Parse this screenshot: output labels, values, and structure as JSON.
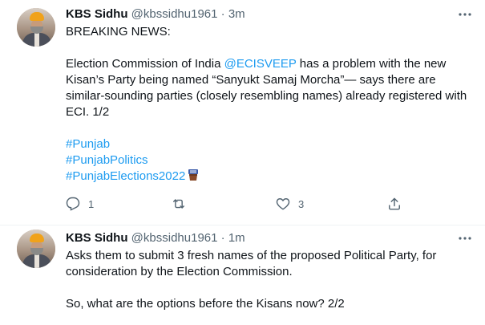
{
  "tweets": [
    {
      "author": {
        "name": "KBS Sidhu",
        "handle": "@kbssidhu1961",
        "time": "3m"
      },
      "separator": "·",
      "lines": [
        {
          "parts": [
            {
              "text": "BREAKING NEWS:",
              "link": false
            }
          ]
        },
        {
          "blank": true
        },
        {
          "parts": [
            {
              "text": "Election Commission of India ",
              "link": false
            },
            {
              "text": "@ECISVEEP",
              "link": true
            },
            {
              "text": " has a problem with the new",
              "link": false
            }
          ]
        },
        {
          "parts": [
            {
              "text": "Kisan’s  Party being named “Sanyukt Samaj Morcha”— says there are",
              "link": false
            }
          ]
        },
        {
          "parts": [
            {
              "text": "similar-sounding parties (closely resembling names) already registered with",
              "link": false
            }
          ]
        },
        {
          "parts": [
            {
              "text": "ECI. 1/2",
              "link": false
            }
          ]
        },
        {
          "blank": true
        },
        {
          "parts": [
            {
              "text": "#Punjab",
              "link": true
            }
          ]
        },
        {
          "parts": [
            {
              "text": "#PunjabPolitics",
              "link": true
            }
          ]
        },
        {
          "parts": [
            {
              "text": "#PunjabElections2022",
              "link": true
            }
          ],
          "emoji": "ballot-box-icon"
        }
      ],
      "actions": {
        "reply_count": "1",
        "retweet_count": "",
        "like_count": "3"
      }
    },
    {
      "author": {
        "name": "KBS Sidhu",
        "handle": "@kbssidhu1961",
        "time": "1m"
      },
      "separator": "·",
      "lines": [
        {
          "parts": [
            {
              "text": "Asks them to submit 3 fresh names of the proposed Political Party, for",
              "link": false
            }
          ]
        },
        {
          "parts": [
            {
              "text": "consideration by the Election Commission.",
              "link": false
            }
          ]
        },
        {
          "blank": true
        },
        {
          "parts": [
            {
              "text": "So, what are the options before the Kisans now? 2/2",
              "link": false
            }
          ]
        }
      ]
    }
  ],
  "colors": {
    "link": "#1d9bf0",
    "secondary": "#536471",
    "text": "#0f1419",
    "divider": "#eff3f4"
  }
}
